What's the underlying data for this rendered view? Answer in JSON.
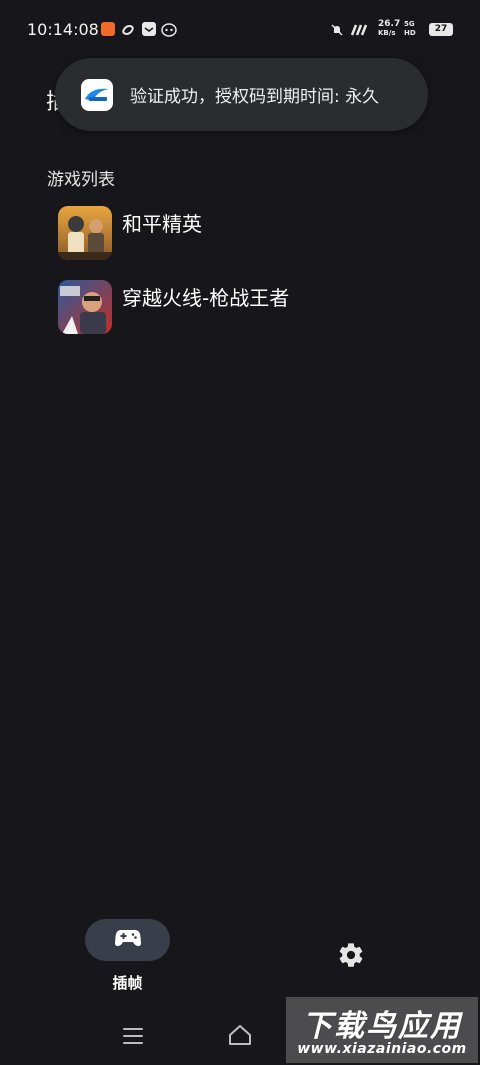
{
  "status_bar": {
    "time": "10:14:08",
    "network_speed_value": "26.7",
    "network_speed_unit": "KB/s",
    "network_type": "5G HD",
    "battery": "27"
  },
  "page": {
    "title": "插"
  },
  "toast": {
    "message": "验证成功，授权码到期时间: 永久"
  },
  "games_section": {
    "header": "游戏列表",
    "items": [
      {
        "name": "和平精英"
      },
      {
        "name": "穿越火线-枪战王者"
      }
    ]
  },
  "bottom_nav": {
    "items": [
      {
        "label": "插帧",
        "icon": "gamepad-icon",
        "active": true
      },
      {
        "label": "",
        "icon": "gear-icon",
        "active": false
      }
    ]
  },
  "watermark": {
    "title": "下载鸟应用",
    "url": "www.xiazainiao.com"
  },
  "colors": {
    "background": "#17171b",
    "toast_bg": "#2b2c30",
    "nav_pill": "#3a3d4a"
  }
}
